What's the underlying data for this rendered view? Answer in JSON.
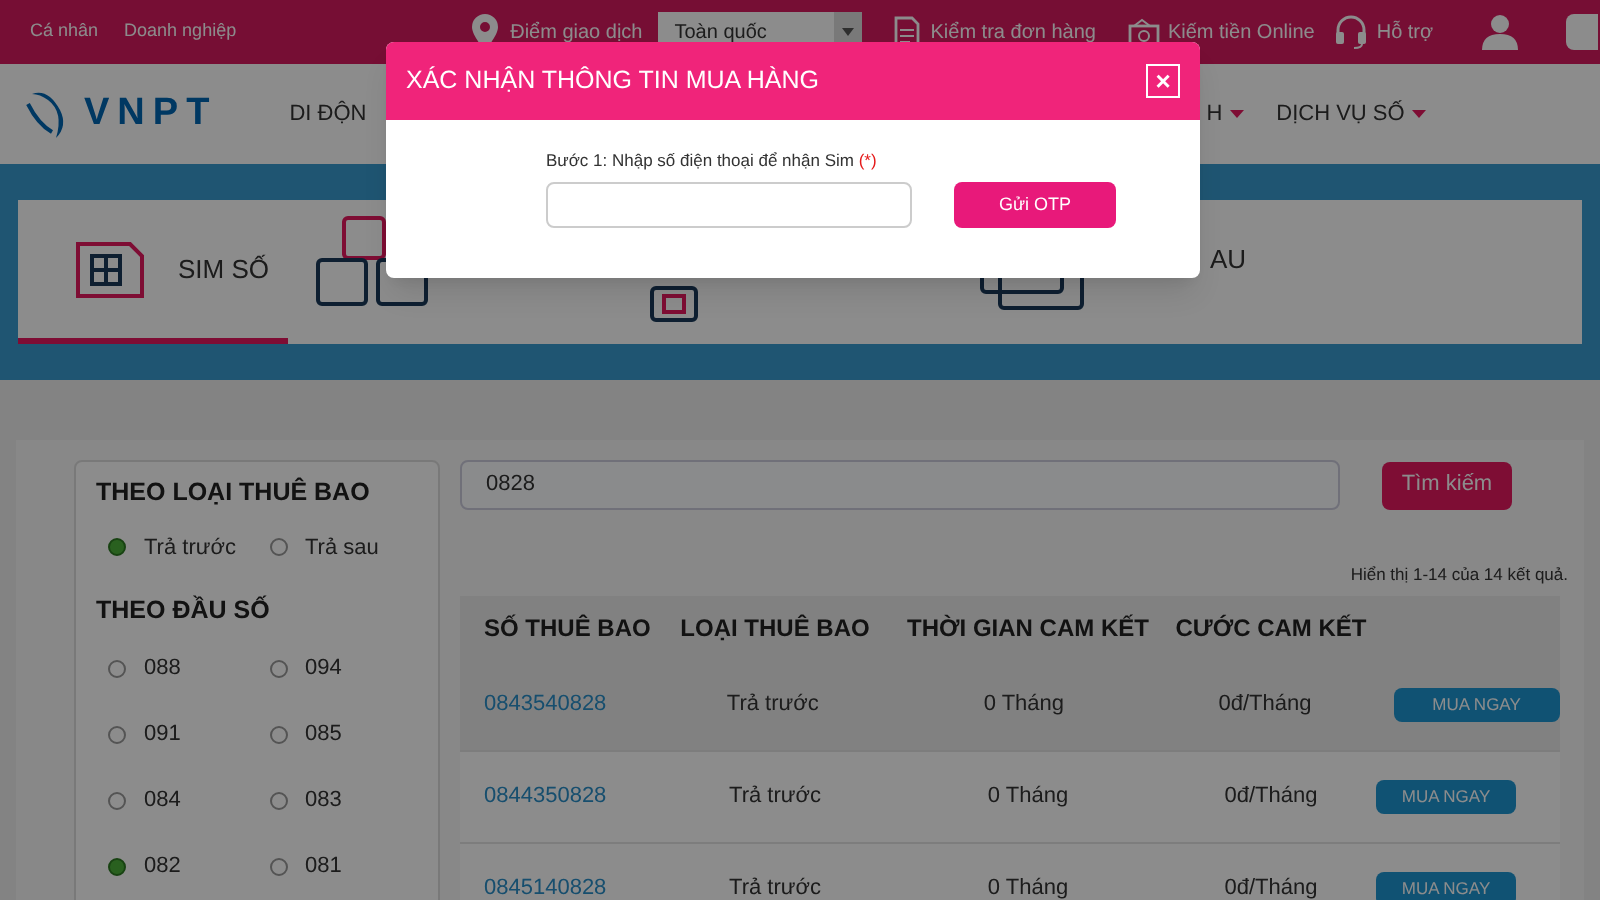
{
  "top_bar": {
    "links": [
      "Cá nhân",
      "Doanh nghiệp"
    ],
    "store_locator": "Điểm giao dịch",
    "region_select": "Toàn quốc",
    "order_check": "Kiểm tra đơn hàng",
    "earn_online": "Kiếm tiền Online",
    "support": "Hỗ trợ"
  },
  "header": {
    "logo": "VNPT",
    "nav": [
      {
        "label": "DI ĐỘN",
        "caret": false
      },
      {
        "label": "H",
        "caret": true
      },
      {
        "label": "DỊCH VỤ SỐ",
        "caret": true
      }
    ]
  },
  "tabs": [
    {
      "label": "SIM SỐ",
      "selected": true
    },
    {
      "selected": false
    },
    {
      "selected": false
    },
    {
      "label": "AU",
      "selected": false
    }
  ],
  "filters": {
    "subscription_title": "THEO LOẠI THUÊ BAO",
    "subscription": [
      {
        "label": "Trả trước",
        "checked": true
      },
      {
        "label": "Trả sau",
        "checked": false
      }
    ],
    "prefix_title": "THEO ĐẦU SỐ",
    "prefixes": [
      {
        "label": "088",
        "checked": false
      },
      {
        "label": "094",
        "checked": false
      },
      {
        "label": "091",
        "checked": false
      },
      {
        "label": "085",
        "checked": false
      },
      {
        "label": "084",
        "checked": false
      },
      {
        "label": "083",
        "checked": false
      },
      {
        "label": "082",
        "checked": true
      },
      {
        "label": "081",
        "checked": false
      }
    ]
  },
  "search": {
    "value": "0828",
    "button": "Tìm kiếm"
  },
  "result_count": "Hiển thị 1-14 của 14 kết quả.",
  "table": {
    "columns": [
      "SỐ THUÊ BAO",
      "LOẠI THUÊ BAO",
      "THỜI GIAN CAM KẾT",
      "CƯỚC CAM KẾT"
    ],
    "rows": [
      {
        "number": "0843540828",
        "type": "Trả trước",
        "term": "0 Tháng",
        "fee": "0đ/Tháng",
        "button": "MUA NGAY",
        "highlighted": true
      },
      {
        "number": "0844350828",
        "type": "Trả trước",
        "term": "0 Tháng",
        "fee": "0đ/Tháng",
        "button": "MUA NGAY",
        "highlighted": false
      },
      {
        "number": "0845140828",
        "type": "Trả trước",
        "term": "0 Tháng",
        "fee": "0đ/Tháng",
        "button": "MUA NGAY",
        "highlighted": false
      }
    ]
  },
  "modal": {
    "title": "XÁC NHẬN THÔNG TIN MUA HÀNG",
    "close": "×",
    "field_label": "Bước 1: Nhập số điện thoại để nhận Sim",
    "required_mark": "(*)",
    "button": "Gửi OTP"
  }
}
